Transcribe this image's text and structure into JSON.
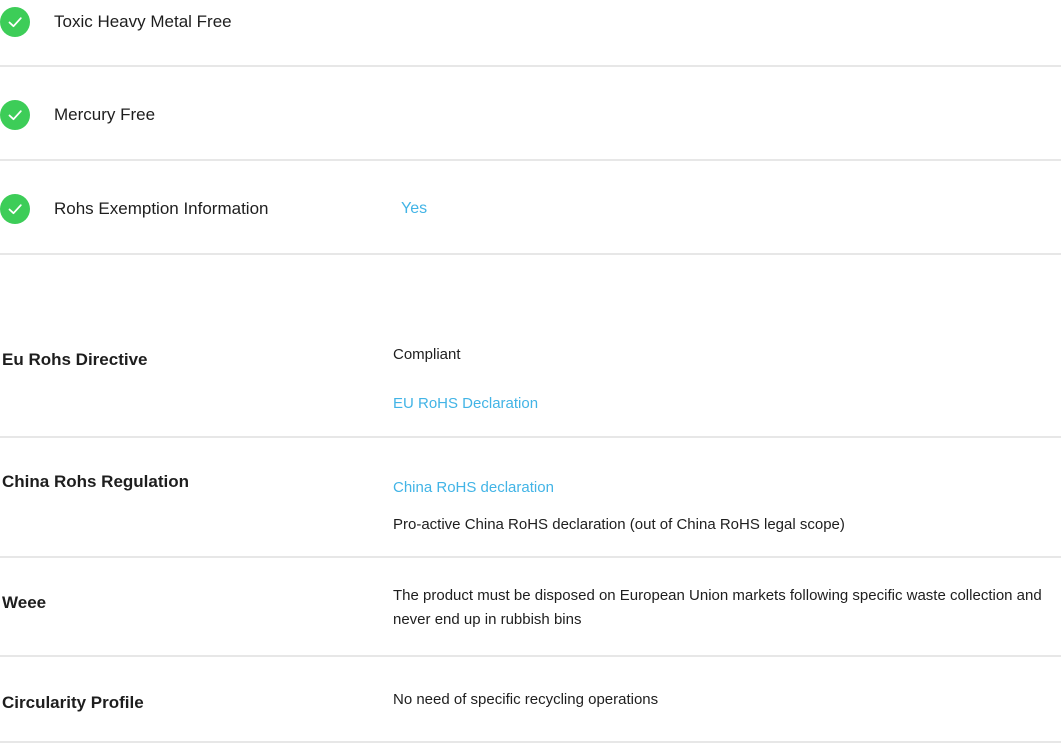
{
  "checklist": [
    {
      "label": "Toxic Heavy Metal Free",
      "value": "",
      "icon": "check-circle-icon"
    },
    {
      "label": "Mercury Free",
      "value": "",
      "icon": "check-circle-icon"
    },
    {
      "label": "Rohs Exemption Information",
      "value": "Yes",
      "icon": "check-circle-icon"
    }
  ],
  "regulations": {
    "eu_rohs": {
      "label": "Eu Rohs Directive",
      "status": "Compliant",
      "link": "EU RoHS Declaration"
    },
    "china_rohs": {
      "label": "China Rohs Regulation",
      "link": "China RoHS declaration",
      "note": "Pro-active China RoHS declaration (out of China RoHS legal scope)"
    },
    "weee": {
      "label": "Weee",
      "text": "The product must be disposed on European Union markets following specific waste collection and never end up in rubbish bins"
    },
    "circularity": {
      "label": "Circularity Profile",
      "text": "No need of specific recycling operations"
    }
  },
  "colors": {
    "check_green": "#3dcd58",
    "link_blue": "#42b4e6",
    "divider": "#e7e7e7",
    "text": "#1e1e1e"
  }
}
